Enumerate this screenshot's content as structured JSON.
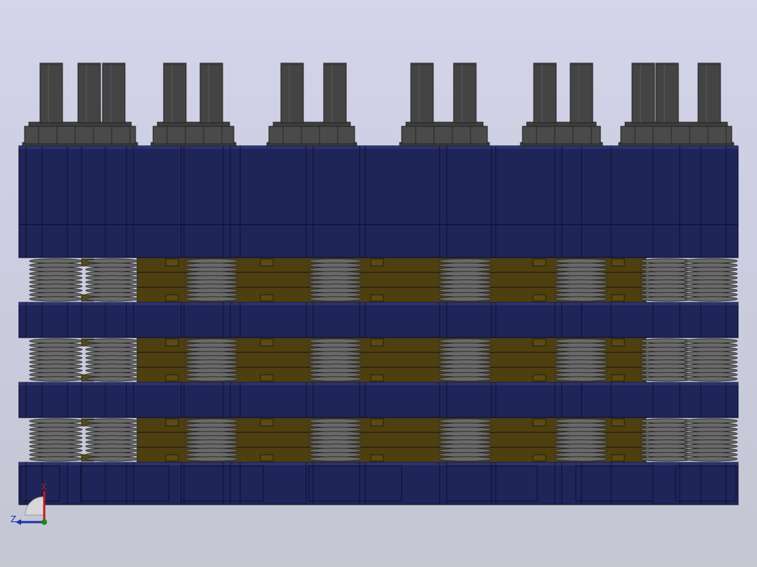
{
  "view": {
    "background_top": "#d4d4ea",
    "background_bottom": "#c4c6d2"
  },
  "assembly": {
    "plate_color": "#1f2559",
    "plate_edge_color": "#0c0f2e",
    "cushion_color": "#4e3f10",
    "spring_color": "#5b5b5b",
    "bolt_color": "#444444",
    "plate_count": 4,
    "spring_layers": 3,
    "bolt_groups": 6
  },
  "triad": {
    "x_label": "X",
    "z_label": "Z",
    "x_color": "#c01818",
    "z_color": "#1c2ea8",
    "origin_color": "#1a8a1a"
  }
}
